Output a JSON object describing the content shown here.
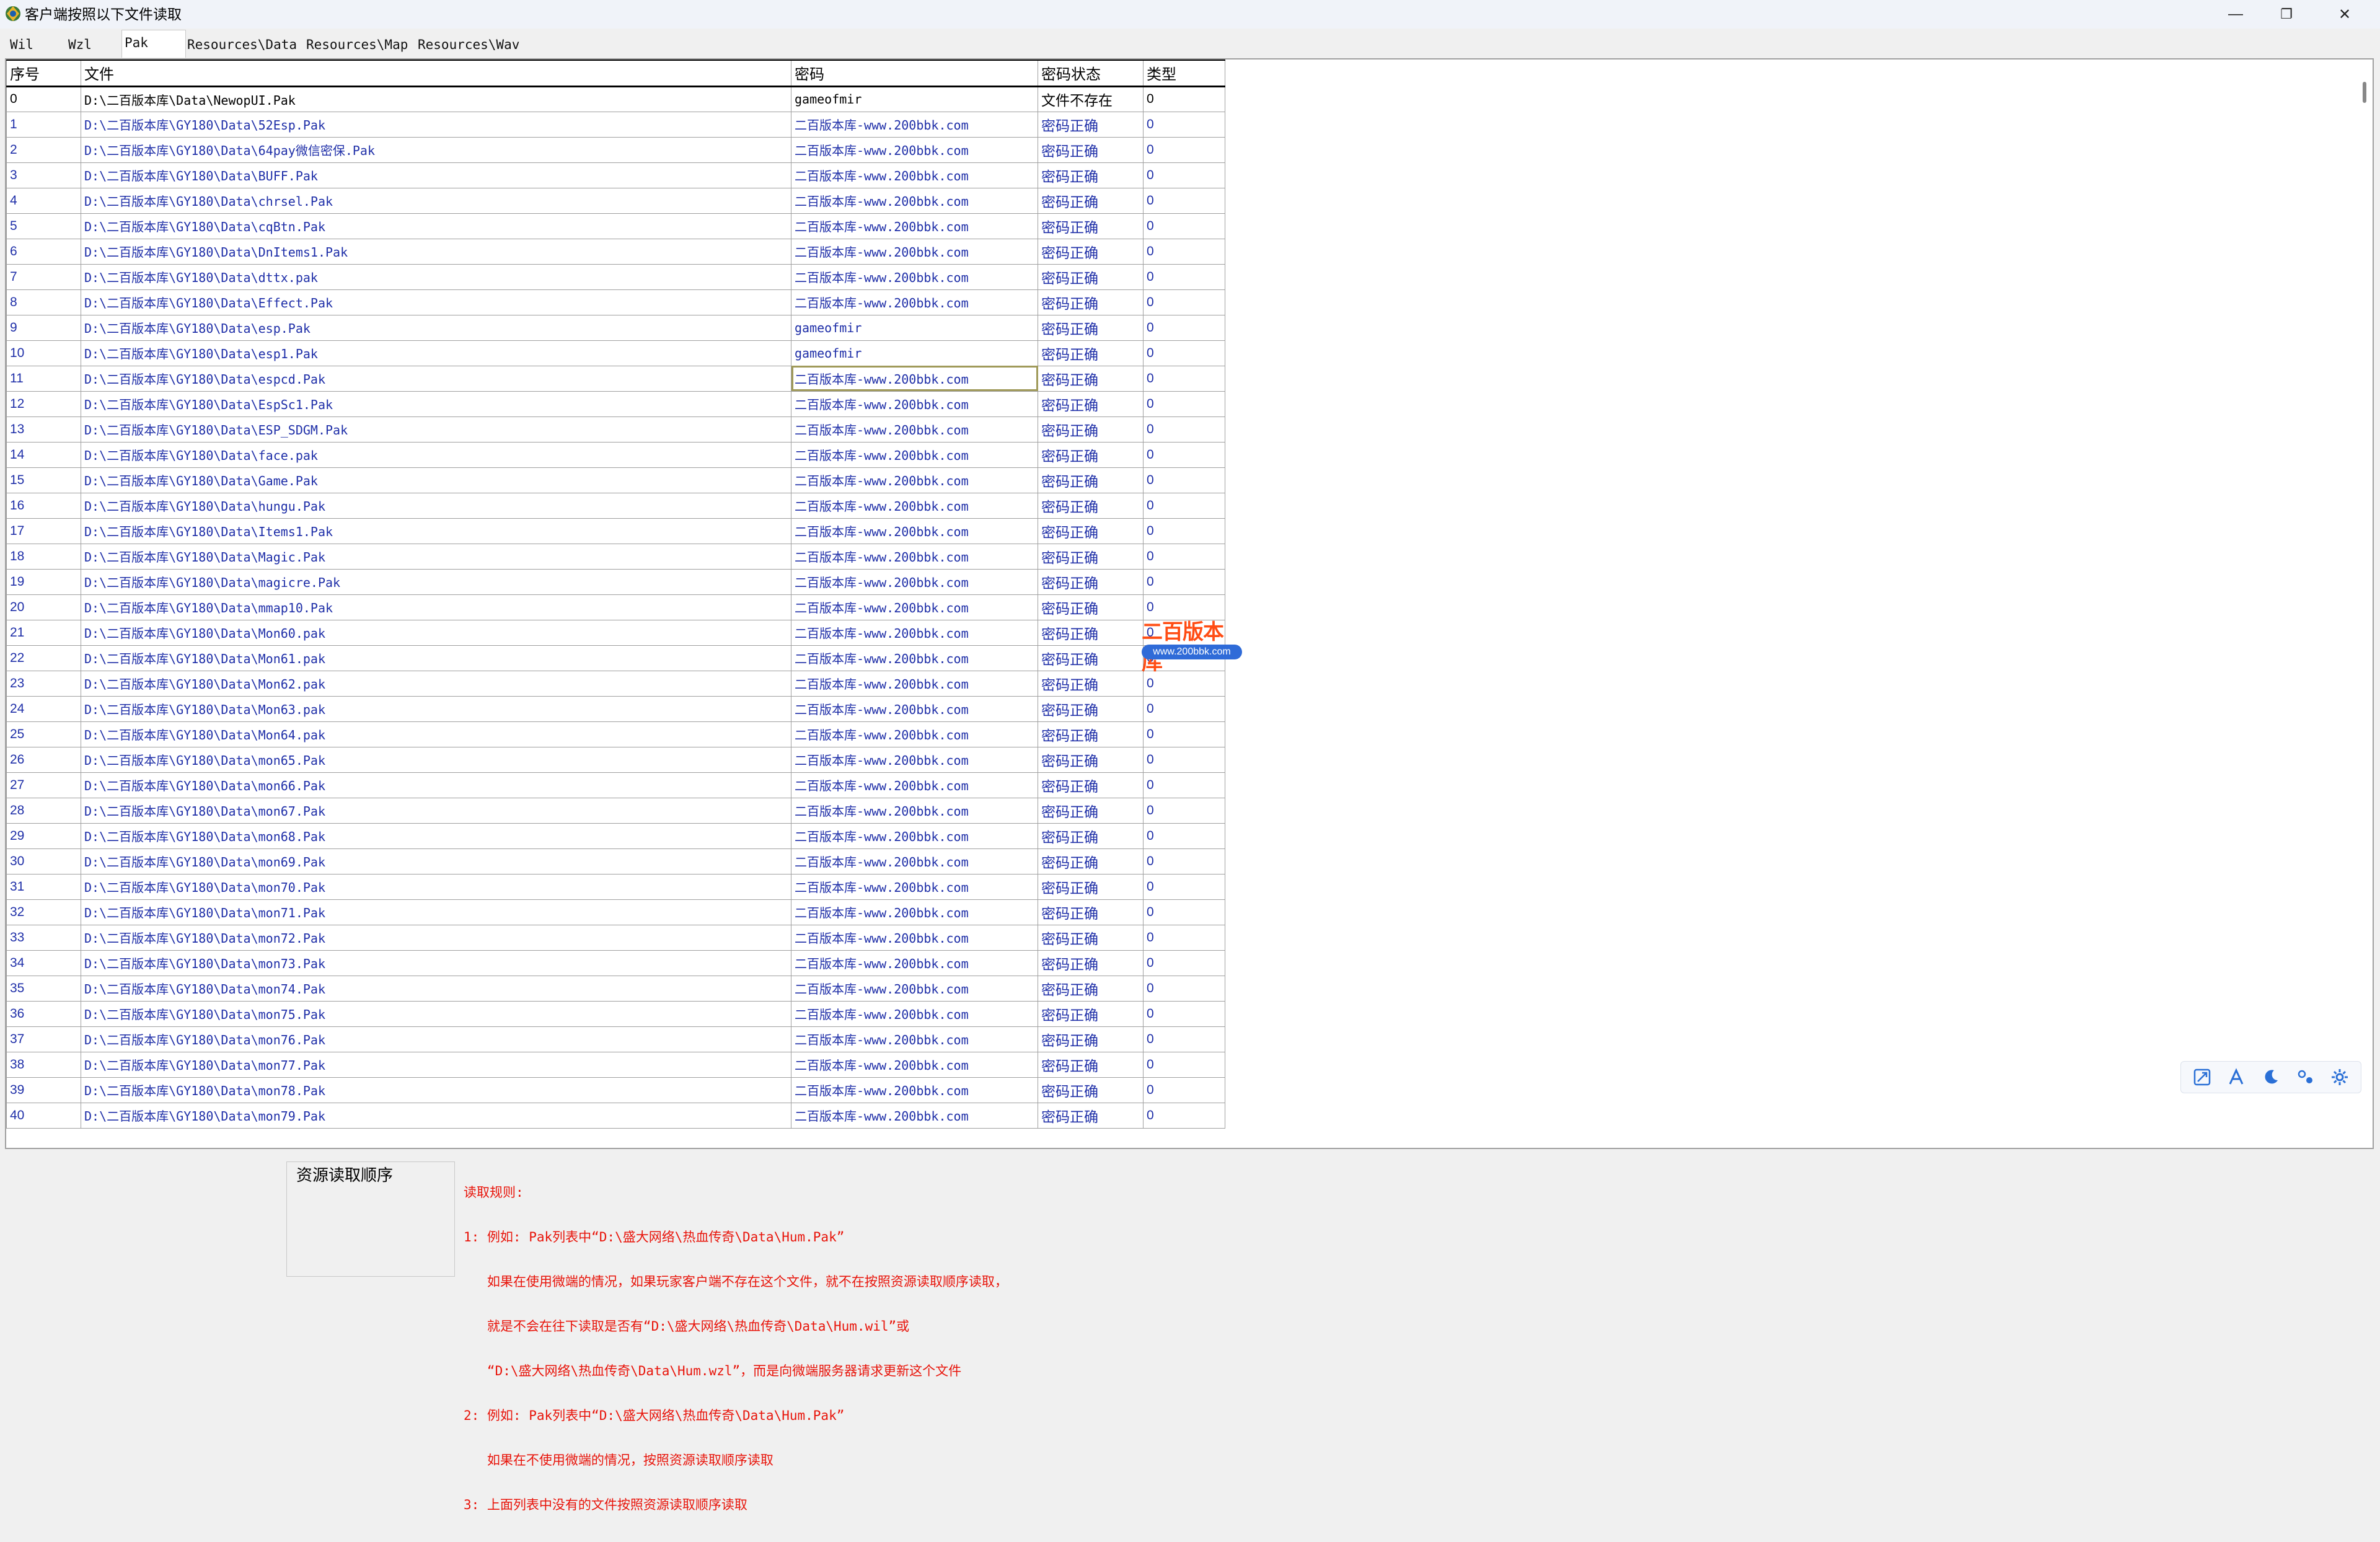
{
  "window": {
    "title": "客户端按照以下文件读取",
    "minimize_glyph": "—",
    "restore_glyph": "❐",
    "close_glyph": "✕"
  },
  "tabs": [
    "Wil",
    "Wzl",
    "Pak",
    "Resources\\Data",
    "Resources\\Map",
    "Resources\\Wav"
  ],
  "active_tab": "Pak",
  "grid": {
    "headers": [
      "序号",
      "文件",
      "密码",
      "密码状态",
      "类型"
    ],
    "rows": [
      [
        "0",
        "D:\\二百版本库\\Data\\NewopUI.Pak",
        "gameofmir",
        "文件不存在",
        "0"
      ],
      [
        "1",
        "D:\\二百版本库\\GY180\\Data\\52Esp.Pak",
        "二百版本库-www.200bbk.com",
        "密码正确",
        "0"
      ],
      [
        "2",
        "D:\\二百版本库\\GY180\\Data\\64pay微信密保.Pak",
        "二百版本库-www.200bbk.com",
        "密码正确",
        "0"
      ],
      [
        "3",
        "D:\\二百版本库\\GY180\\Data\\BUFF.Pak",
        "二百版本库-www.200bbk.com",
        "密码正确",
        "0"
      ],
      [
        "4",
        "D:\\二百版本库\\GY180\\Data\\chrsel.Pak",
        "二百版本库-www.200bbk.com",
        "密码正确",
        "0"
      ],
      [
        "5",
        "D:\\二百版本库\\GY180\\Data\\cqBtn.Pak",
        "二百版本库-www.200bbk.com",
        "密码正确",
        "0"
      ],
      [
        "6",
        "D:\\二百版本库\\GY180\\Data\\DnItems1.Pak",
        "二百版本库-www.200bbk.com",
        "密码正确",
        "0"
      ],
      [
        "7",
        "D:\\二百版本库\\GY180\\Data\\dttx.pak",
        "二百版本库-www.200bbk.com",
        "密码正确",
        "0"
      ],
      [
        "8",
        "D:\\二百版本库\\GY180\\Data\\Effect.Pak",
        "二百版本库-www.200bbk.com",
        "密码正确",
        "0"
      ],
      [
        "9",
        "D:\\二百版本库\\GY180\\Data\\esp.Pak",
        "gameofmir",
        "密码正确",
        "0"
      ],
      [
        "10",
        "D:\\二百版本库\\GY180\\Data\\esp1.Pak",
        "gameofmir",
        "密码正确",
        "0"
      ],
      [
        "11",
        "D:\\二百版本库\\GY180\\Data\\espcd.Pak",
        "二百版本库-www.200bbk.com",
        "密码正确",
        "0"
      ],
      [
        "12",
        "D:\\二百版本库\\GY180\\Data\\EspSc1.Pak",
        "二百版本库-www.200bbk.com",
        "密码正确",
        "0"
      ],
      [
        "13",
        "D:\\二百版本库\\GY180\\Data\\ESP_SDGM.Pak",
        "二百版本库-www.200bbk.com",
        "密码正确",
        "0"
      ],
      [
        "14",
        "D:\\二百版本库\\GY180\\Data\\face.pak",
        "二百版本库-www.200bbk.com",
        "密码正确",
        "0"
      ],
      [
        "15",
        "D:\\二百版本库\\GY180\\Data\\Game.Pak",
        "二百版本库-www.200bbk.com",
        "密码正确",
        "0"
      ],
      [
        "16",
        "D:\\二百版本库\\GY180\\Data\\hungu.Pak",
        "二百版本库-www.200bbk.com",
        "密码正确",
        "0"
      ],
      [
        "17",
        "D:\\二百版本库\\GY180\\Data\\Items1.Pak",
        "二百版本库-www.200bbk.com",
        "密码正确",
        "0"
      ],
      [
        "18",
        "D:\\二百版本库\\GY180\\Data\\Magic.Pak",
        "二百版本库-www.200bbk.com",
        "密码正确",
        "0"
      ],
      [
        "19",
        "D:\\二百版本库\\GY180\\Data\\magicre.Pak",
        "二百版本库-www.200bbk.com",
        "密码正确",
        "0"
      ],
      [
        "20",
        "D:\\二百版本库\\GY180\\Data\\mmap10.Pak",
        "二百版本库-www.200bbk.com",
        "密码正确",
        "0"
      ],
      [
        "21",
        "D:\\二百版本库\\GY180\\Data\\Mon60.pak",
        "二百版本库-www.200bbk.com",
        "密码正确",
        "0"
      ],
      [
        "22",
        "D:\\二百版本库\\GY180\\Data\\Mon61.pak",
        "二百版本库-www.200bbk.com",
        "密码正确",
        "0"
      ],
      [
        "23",
        "D:\\二百版本库\\GY180\\Data\\Mon62.pak",
        "二百版本库-www.200bbk.com",
        "密码正确",
        "0"
      ],
      [
        "24",
        "D:\\二百版本库\\GY180\\Data\\Mon63.pak",
        "二百版本库-www.200bbk.com",
        "密码正确",
        "0"
      ],
      [
        "25",
        "D:\\二百版本库\\GY180\\Data\\Mon64.pak",
        "二百版本库-www.200bbk.com",
        "密码正确",
        "0"
      ],
      [
        "26",
        "D:\\二百版本库\\GY180\\Data\\mon65.Pak",
        "二百版本库-www.200bbk.com",
        "密码正确",
        "0"
      ],
      [
        "27",
        "D:\\二百版本库\\GY180\\Data\\mon66.Pak",
        "二百版本库-www.200bbk.com",
        "密码正确",
        "0"
      ],
      [
        "28",
        "D:\\二百版本库\\GY180\\Data\\mon67.Pak",
        "二百版本库-www.200bbk.com",
        "密码正确",
        "0"
      ],
      [
        "29",
        "D:\\二百版本库\\GY180\\Data\\mon68.Pak",
        "二百版本库-www.200bbk.com",
        "密码正确",
        "0"
      ],
      [
        "30",
        "D:\\二百版本库\\GY180\\Data\\mon69.Pak",
        "二百版本库-www.200bbk.com",
        "密码正确",
        "0"
      ],
      [
        "31",
        "D:\\二百版本库\\GY180\\Data\\mon70.Pak",
        "二百版本库-www.200bbk.com",
        "密码正确",
        "0"
      ],
      [
        "32",
        "D:\\二百版本库\\GY180\\Data\\mon71.Pak",
        "二百版本库-www.200bbk.com",
        "密码正确",
        "0"
      ],
      [
        "33",
        "D:\\二百版本库\\GY180\\Data\\mon72.Pak",
        "二百版本库-www.200bbk.com",
        "密码正确",
        "0"
      ],
      [
        "34",
        "D:\\二百版本库\\GY180\\Data\\mon73.Pak",
        "二百版本库-www.200bbk.com",
        "密码正确",
        "0"
      ],
      [
        "35",
        "D:\\二百版本库\\GY180\\Data\\mon74.Pak",
        "二百版本库-www.200bbk.com",
        "密码正确",
        "0"
      ],
      [
        "36",
        "D:\\二百版本库\\GY180\\Data\\mon75.Pak",
        "二百版本库-www.200bbk.com",
        "密码正确",
        "0"
      ],
      [
        "37",
        "D:\\二百版本库\\GY180\\Data\\mon76.Pak",
        "二百版本库-www.200bbk.com",
        "密码正确",
        "0"
      ],
      [
        "38",
        "D:\\二百版本库\\GY180\\Data\\mon77.Pak",
        "二百版本库-www.200bbk.com",
        "密码正确",
        "0"
      ],
      [
        "39",
        "D:\\二百版本库\\GY180\\Data\\mon78.Pak",
        "二百版本库-www.200bbk.com",
        "密码正确",
        "0"
      ],
      [
        "40",
        "D:\\二百版本库\\GY180\\Data\\mon79.Pak",
        "二百版本库-www.200bbk.com",
        "密码正确",
        "0"
      ]
    ]
  },
  "watermark": {
    "logo_text": "二百版本库",
    "url": "www.200bbk.com"
  },
  "float_toolbar": {
    "icons": [
      "image-search-icon",
      "text-icon",
      "moon-icon",
      "translate-icon",
      "gear-icon"
    ]
  },
  "bottom": {
    "order_label": "资源读取顺序",
    "rules": [
      "读取规则:",
      "1: 例如: Pak列表中“D:\\盛大网络\\热血传奇\\Data\\Hum.Pak”",
      "   如果在使用微端的情况，如果玩家客户端不存在这个文件，就不在按照资源读取顺序读取，",
      "   就是不会在往下读取是否有“D:\\盛大网络\\热血传奇\\Data\\Hum.wil”或",
      "   “D:\\盛大网络\\热血传奇\\Data\\Hum.wzl”，而是向微端服务器请求更新这个文件",
      "2: 例如: Pak列表中“D:\\盛大网络\\热血传奇\\Data\\Hum.Pak”",
      "   如果在不使用微端的情况，按照资源读取顺序读取",
      "3: 上面列表中没有的文件按照资源读取顺序读取"
    ]
  },
  "colors": {
    "row_text": "#1f2fa8",
    "rules_text": "#e8140a",
    "watermark_text": "#ff4d14",
    "watermark_pill": "#2f6bd8"
  }
}
